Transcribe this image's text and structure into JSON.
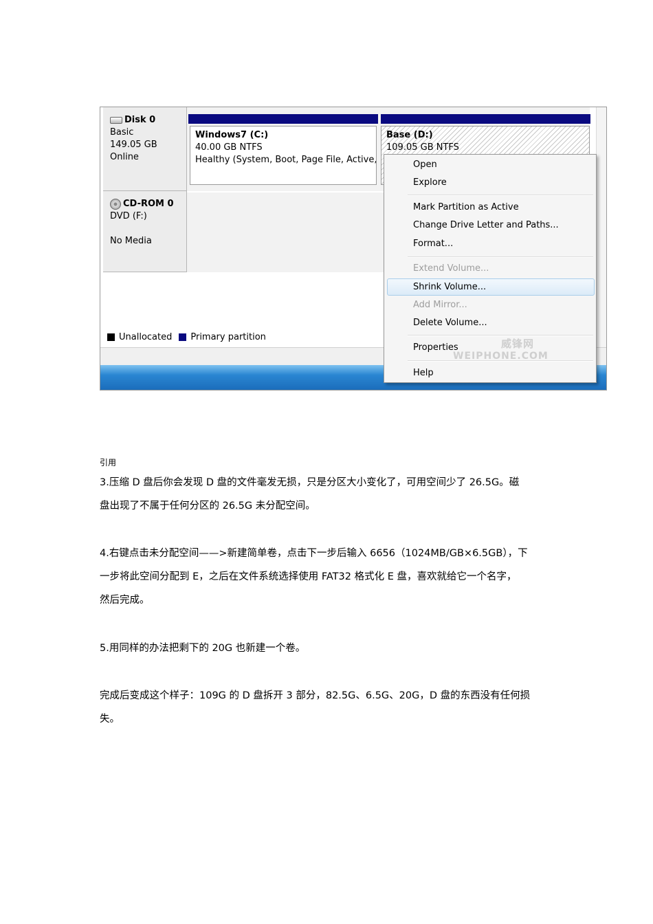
{
  "screenshot": {
    "disk0": {
      "name": "Disk 0",
      "type": "Basic",
      "size": "149.05 GB",
      "status": "Online"
    },
    "cdrom0": {
      "name": "CD-ROM 0",
      "drive": "DVD (F:)",
      "status": "No Media"
    },
    "partitions": [
      {
        "title": "Windows7  (C:)",
        "size": "40.00 GB NTFS",
        "status": "Healthy (System, Boot, Page File, Active, C"
      },
      {
        "title": "Base  (D:)",
        "size": "109.05 GB NTFS"
      }
    ],
    "legend": {
      "unallocated": "Unallocated",
      "primary": "Primary partition"
    },
    "menu": {
      "open": "Open",
      "explore": "Explore",
      "mark_active": "Mark Partition as Active",
      "change_letter": "Change Drive Letter and Paths...",
      "format": "Format...",
      "extend": "Extend Volume...",
      "shrink": "Shrink Volume...",
      "add_mirror": "Add Mirror...",
      "delete": "Delete Volume...",
      "properties": "Properties",
      "help": "Help"
    },
    "watermark": {
      "line1": "威锋网",
      "line2": "WEIPHONE.COM"
    },
    "colors": {
      "primary": "#0a0a80",
      "unallocated": "#000000"
    }
  },
  "document": {
    "quote_label": "引用",
    "p3_line1": "3.压缩 D 盘后你会发现 D 盘的文件毫发无损，只是分区大小变化了，可用空间少了 26.5G。磁",
    "p3_line2": "盘出现了不属于任何分区的 26.5G 未分配空间。",
    "p4_line1": "4.右键点击未分配空间——>新建简单卷，点击下一步后输入 6656（1024MB/GB×6.5GB），下",
    "p4_line2": "一步将此空间分配到 E，之后在文件系统选择使用 FAT32 格式化 E 盘，喜欢就给它一个名字，",
    "p4_line3": "然后完成。",
    "p5": "5.用同样的办法把剩下的 20G 也新建一个卷。",
    "p6_line1": "完成后变成这个样子：109G 的 D 盘拆开 3 部分，82.5G、6.5G、20G，D 盘的东西没有任何损",
    "p6_line2": "失。"
  }
}
